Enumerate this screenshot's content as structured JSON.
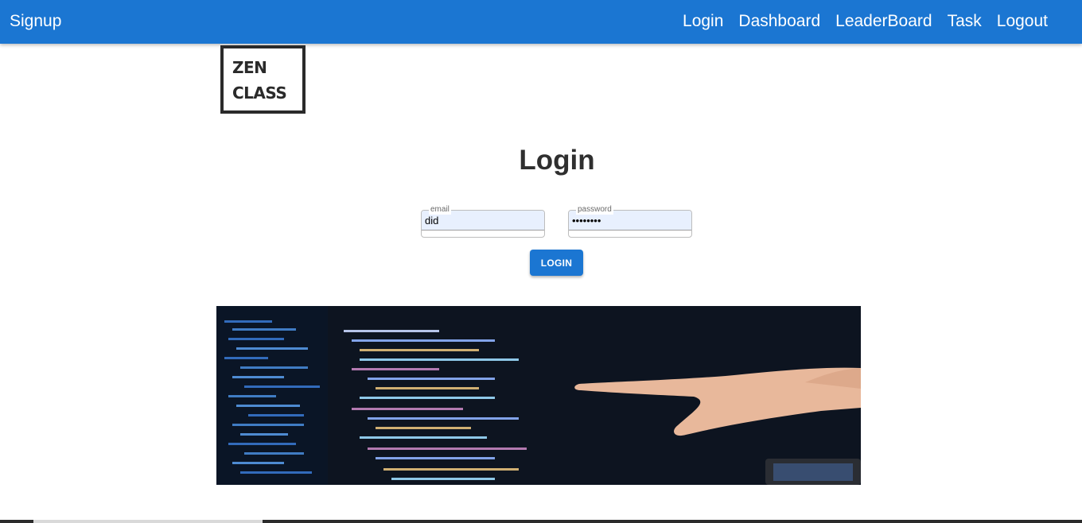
{
  "appbar": {
    "brand": "Signup",
    "nav": [
      "Login",
      "Dashboard",
      "LeaderBoard",
      "Task",
      "Logout"
    ],
    "color": "#1b76d2"
  },
  "logo": {
    "line1": "ZEN",
    "line2": "CLASS"
  },
  "page": {
    "title": "Login"
  },
  "form": {
    "email": {
      "label": "email",
      "value": "did"
    },
    "password": {
      "label": "password",
      "value": "••••••••"
    },
    "submit_label": "LOGIN"
  },
  "hero": {
    "icon": "code-screen-pointing-hand-image"
  }
}
